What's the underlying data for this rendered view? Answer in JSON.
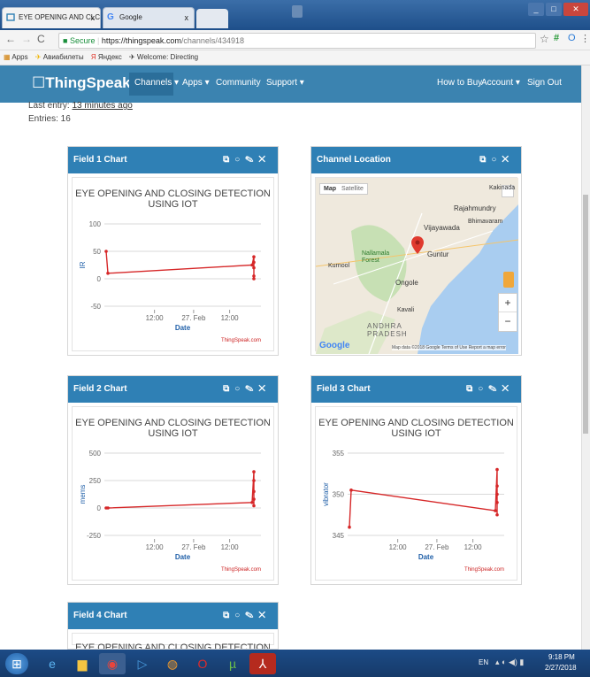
{
  "browser": {
    "tabs": [
      {
        "label": "EYE OPENING AND CLC",
        "close": "x"
      },
      {
        "label": "Google",
        "close": "x"
      }
    ],
    "url_secure": "Secure",
    "url_host": "https://thingspeak.com",
    "url_path": "/channels/434918",
    "bookmarks": [
      "Apps",
      "Авиабилеты",
      "Яндекс",
      "Welcome: Directing"
    ]
  },
  "nav": {
    "logo": "ThingSpeak",
    "tm": "™",
    "left_items": [
      "Channels ▾",
      "Apps ▾",
      "Community",
      "Support ▾"
    ],
    "right_items": [
      "How to Buy",
      "Account ▾",
      "Sign Out"
    ]
  },
  "channel": {
    "last_entry_label": "Last entry:",
    "last_entry_value": "13 minutes ago",
    "entries": "Entries: 16"
  },
  "panels": {
    "field1": {
      "title": "Field 1 Chart"
    },
    "location": {
      "title": "Channel Location"
    },
    "field2": {
      "title": "Field 2 Chart"
    },
    "field3": {
      "title": "Field 3 Chart"
    },
    "field4": {
      "title": "Field 4 Chart"
    }
  },
  "chart_common": {
    "title_line1": "EYE OPENING AND CLOSING DETECTION",
    "title_line2": "USING IOT",
    "xlabel": "Date",
    "credit": "ThingSpeak.com",
    "x_ticks": [
      "12:00",
      "27. Feb",
      "12:00"
    ]
  },
  "chart_data": [
    {
      "type": "line",
      "ylabel": "IR",
      "y_ticks": [
        "100",
        "50",
        "0",
        "-50"
      ],
      "ylim": [
        -50,
        100
      ],
      "color": "#d62728",
      "series": [
        {
          "values": [
            50,
            10,
            25,
            40,
            30,
            20,
            5,
            0
          ]
        }
      ]
    },
    {
      "type": "line",
      "ylabel": "mems",
      "y_ticks": [
        "500",
        "250",
        "0",
        "-250"
      ],
      "ylim": [
        -250,
        500
      ],
      "color": "#d62728",
      "series": [
        {
          "values": [
            0,
            0,
            50,
            330,
            250,
            150,
            80,
            20
          ]
        }
      ]
    },
    {
      "type": "line",
      "ylabel": "vibrator",
      "y_ticks": [
        "355",
        "350",
        "345"
      ],
      "ylim": [
        345,
        355
      ],
      "color": "#d62728",
      "series": [
        {
          "values": [
            346,
            350.5,
            348,
            353,
            351,
            350,
            349,
            347.5
          ]
        }
      ]
    }
  ],
  "map": {
    "map_btn": "Map",
    "satellite_btn": "Satellite",
    "places": [
      "Rajahmundry",
      "Vijayawada",
      "Bhimavaram",
      "Guntur",
      "Nallamala Forest",
      "Kurnool",
      "Ongole",
      "ANDHRA PRADESH",
      "Kakinada",
      "Kavali"
    ],
    "google": "Google",
    "footer": "Map data ©2018 Google   Terms of Use   Report a map error",
    "zoom_in": "+",
    "zoom_out": "−"
  },
  "taskbar": {
    "lang": "EN",
    "time": "9:18 PM",
    "date": "2/27/2018"
  }
}
